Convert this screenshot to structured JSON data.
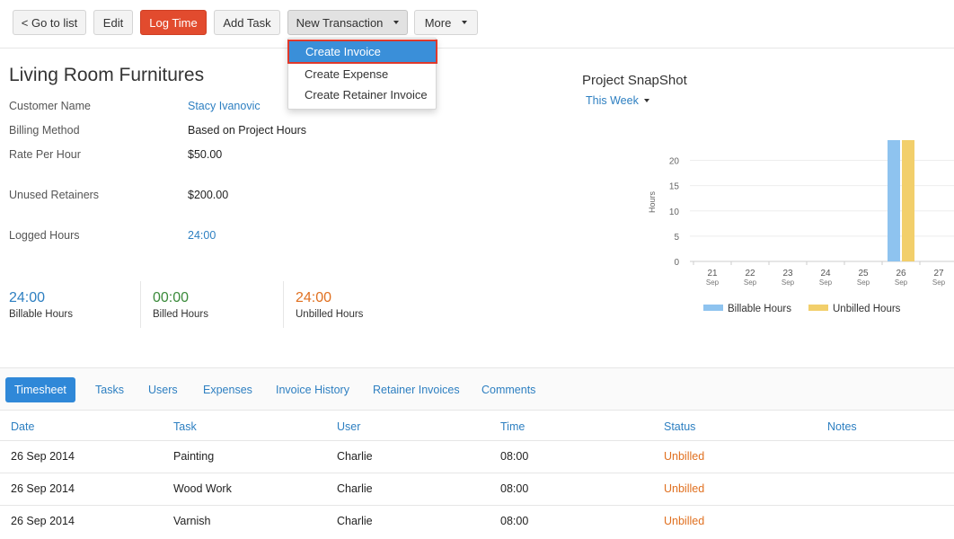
{
  "toolbar": {
    "go_to_list": "< Go to list",
    "edit": "Edit",
    "log_time": "Log Time",
    "add_task": "Add Task",
    "new_transaction": "New Transaction",
    "more": "More"
  },
  "dropdown": {
    "items": [
      "Create Invoice",
      "Create Expense",
      "Create Retainer Invoice"
    ]
  },
  "project": {
    "title": "Living Room Furnitures",
    "fields": [
      {
        "label": "Customer Name",
        "value": "Stacy Ivanovic"
      },
      {
        "label": "Billing Method",
        "value": "Based on Project Hours"
      },
      {
        "label": "Rate Per Hour",
        "value": "$50.00"
      },
      {
        "label": "Unused Retainers",
        "value": "$200.00"
      },
      {
        "label": "Logged Hours",
        "value": "24:00"
      }
    ]
  },
  "stats": [
    {
      "value": "24:00",
      "label": "Billable Hours"
    },
    {
      "value": "00:00",
      "label": "Billed Hours"
    },
    {
      "value": "24:00",
      "label": "Unbilled Hours"
    }
  ],
  "snapshot": {
    "title": "Project SnapShot",
    "period": "This Week"
  },
  "colors": {
    "billable": "#8ec3ef",
    "unbilled": "#f2cf6b",
    "stat_billable": "#2d7fc1",
    "stat_billed": "#3a8a3a",
    "stat_unbilled": "#e07020"
  },
  "chart_data": {
    "type": "bar",
    "ylabel": "Hours",
    "ylim": [
      0,
      24
    ],
    "yticks": [
      0,
      5,
      10,
      15,
      20
    ],
    "categories": [
      "21",
      "22",
      "23",
      "24",
      "25",
      "26",
      "27"
    ],
    "category_sublabel": "Sep",
    "series": [
      {
        "name": "Billable Hours",
        "values": [
          0,
          0,
          0,
          0,
          0,
          24,
          0
        ]
      },
      {
        "name": "Unbilled Hours",
        "values": [
          0,
          0,
          0,
          0,
          0,
          24,
          0
        ]
      }
    ],
    "legend": "bottom"
  },
  "tabs": [
    "Timesheet",
    "Tasks",
    "Users",
    "Expenses",
    "Invoice History",
    "Retainer Invoices",
    "Comments"
  ],
  "table": {
    "columns": [
      "Date",
      "Task",
      "User",
      "Time",
      "Status",
      "Notes"
    ],
    "rows": [
      [
        "26 Sep 2014",
        "Painting",
        "Charlie",
        "08:00",
        "Unbilled",
        ""
      ],
      [
        "26 Sep 2014",
        "Wood Work",
        "Charlie",
        "08:00",
        "Unbilled",
        ""
      ],
      [
        "26 Sep 2014",
        "Varnish",
        "Charlie",
        "08:00",
        "Unbilled",
        ""
      ]
    ]
  }
}
